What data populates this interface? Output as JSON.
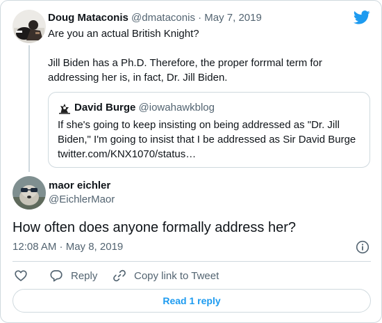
{
  "parent_tweet": {
    "author_name": "Doug Mataconis",
    "handle_date": "@dmataconis · May 7, 2019",
    "line1": "Are you an actual British Knight?",
    "line2": "Jill Biden has a Ph.D. Therefore, the proper forrmal term for addressing her is, in fact, Dr. Jill Biden."
  },
  "quoted_tweet": {
    "author_name": "David Burge",
    "handle": "@iowahawkblog",
    "text": "If she's going to keep insisting on being addressed as \"Dr. Jill Biden,\" I'm going to insist that I be addressed as Sir David Burge twitter.com/KNX1070/status…"
  },
  "main_tweet": {
    "author_name": "maor eichler",
    "handle": "@EichlerMaor",
    "text": "How often does anyone formally address her?",
    "timestamp": "12:08 AM · May 8, 2019"
  },
  "actions": {
    "reply_label": "Reply",
    "copy_label": "Copy link to Tweet",
    "read_replies_label": "Read 1 reply"
  },
  "icons": {
    "brand": "twitter-bird-icon",
    "info": "info-icon",
    "like": "heart-icon",
    "reply": "speech-bubble-icon",
    "copy": "link-icon"
  },
  "colors": {
    "accent": "#1d9bf0",
    "text": "#0f1419",
    "muted": "#536471",
    "border": "#cfd9de"
  }
}
